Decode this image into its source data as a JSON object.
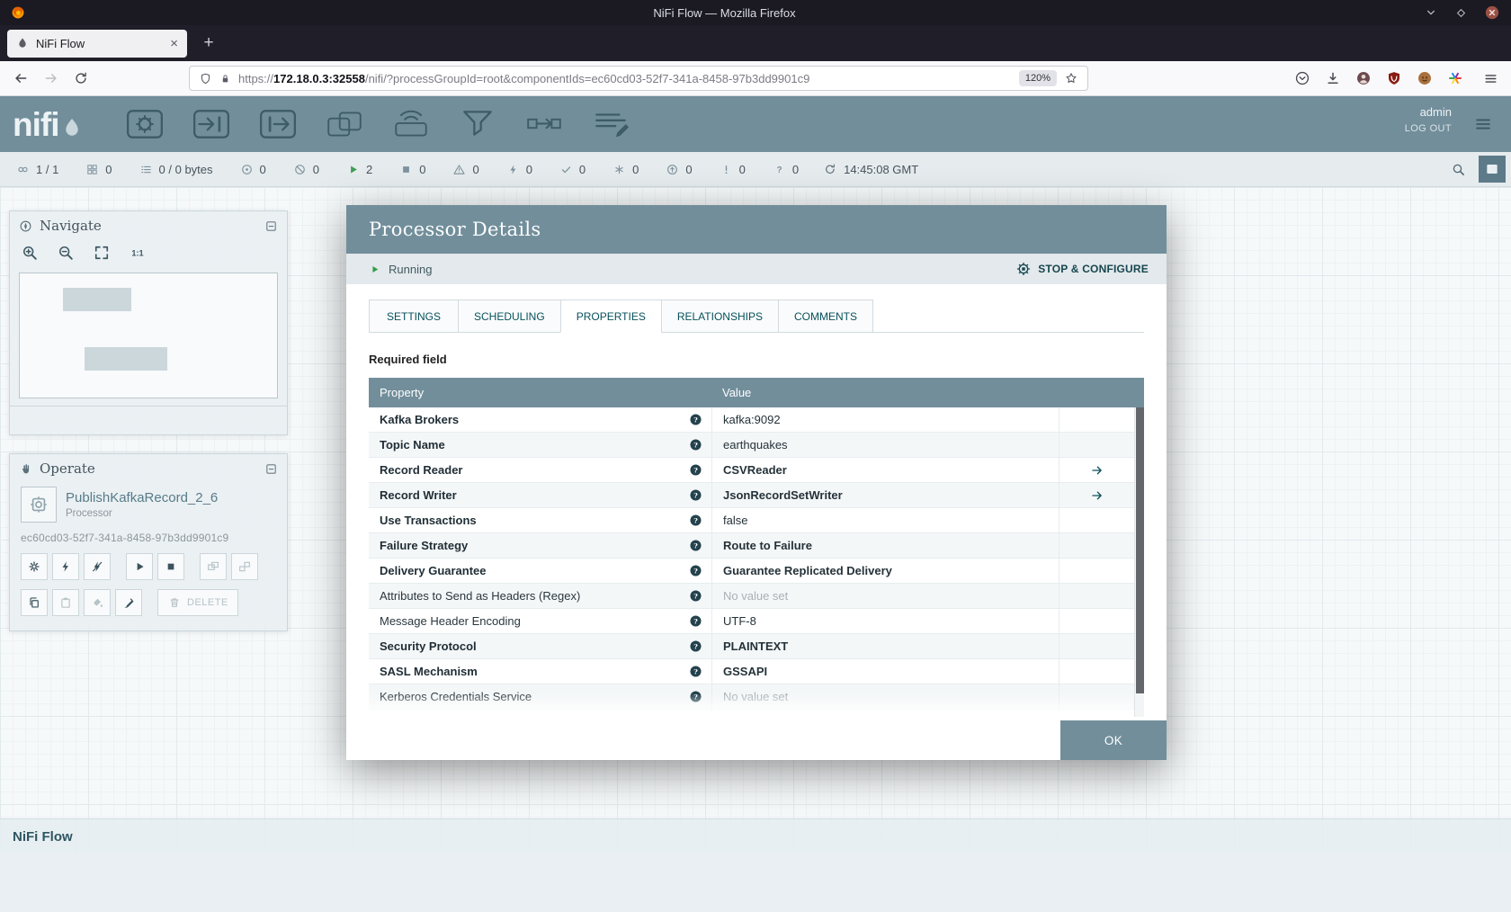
{
  "titlebar": {
    "title": "NiFi Flow — Mozilla Firefox"
  },
  "tabs": {
    "active_tab_title": "NiFi Flow",
    "new_tab_label": "+"
  },
  "navbar": {
    "url_scheme": "https://",
    "url_host": "172.18.0.3:32558",
    "url_path": "/nifi/?processGroupId=root&componentIds=ec60cd03-52f7-341a-8458-97b3dd9901c9",
    "zoom_badge": "120%",
    "right_icons": [
      "pocket-icon",
      "downloads-icon",
      "account-icon",
      "ublock-icon",
      "profile-icon",
      "extension-pinwheel-icon"
    ]
  },
  "nifi": {
    "logo_text": "nifi",
    "user": "admin",
    "logout_label": "LOG OUT",
    "toolbar_icons": [
      "processor-icon",
      "input-port-icon",
      "output-port-icon",
      "process-group-icon",
      "remote-process-group-icon",
      "funnel-icon",
      "template-icon",
      "label-icon"
    ]
  },
  "statusbar": {
    "items": [
      {
        "icon": "cluster-icon",
        "value": "1 / 1"
      },
      {
        "icon": "threads-icon",
        "value": "0"
      },
      {
        "icon": "queued-icon",
        "value": "0 / 0 bytes"
      },
      {
        "icon": "transmitting-icon",
        "value": "0"
      },
      {
        "icon": "not-transmitting-icon",
        "value": "0"
      },
      {
        "icon": "running-icon",
        "value": "2",
        "color": "#3f9e54"
      },
      {
        "icon": "stopped-icon",
        "value": "0"
      },
      {
        "icon": "invalid-icon",
        "value": "0"
      },
      {
        "icon": "disabled-icon",
        "value": "0"
      },
      {
        "icon": "up-to-date-icon",
        "value": "0"
      },
      {
        "icon": "locally-modified-icon",
        "value": "0"
      },
      {
        "icon": "stale-icon",
        "value": "0"
      },
      {
        "icon": "locally-modified-stale-icon",
        "value": "0"
      },
      {
        "icon": "sync-failure-icon",
        "value": "0"
      }
    ],
    "refresh_time": "14:45:08 GMT"
  },
  "navigate": {
    "title": "Navigate"
  },
  "operate": {
    "title": "Operate",
    "name": "PublishKafkaRecord_2_6",
    "type": "Processor",
    "id": "ec60cd03-52f7-341a-8458-97b3dd9901c9",
    "delete_label": "DELETE",
    "buttons_row1": [
      {
        "icon": "gear-icon",
        "disabled": false
      },
      {
        "icon": "bolt-icon",
        "disabled": false
      },
      {
        "icon": "bolt-slash-icon",
        "disabled": false
      },
      {
        "icon": "start-icon",
        "disabled": false
      },
      {
        "icon": "stop-icon",
        "disabled": false
      },
      {
        "icon": "group-icon",
        "disabled": true
      },
      {
        "icon": "ungroup-icon",
        "disabled": true
      }
    ],
    "buttons_row2": [
      {
        "icon": "copy-icon",
        "disabled": false
      },
      {
        "icon": "paste-icon",
        "disabled": true
      },
      {
        "icon": "fill-color-icon",
        "disabled": true
      },
      {
        "icon": "brush-icon",
        "disabled": false
      }
    ]
  },
  "dialog": {
    "title": "Processor Details",
    "status": "Running",
    "action": "STOP & CONFIGURE",
    "tabs": [
      "SETTINGS",
      "SCHEDULING",
      "PROPERTIES",
      "RELATIONSHIPS",
      "COMMENTS"
    ],
    "active_tab": "PROPERTIES",
    "required_note": "Required field",
    "ok_label": "OK",
    "table": {
      "headers": [
        "Property",
        "Value"
      ],
      "rows": [
        {
          "property": "Kafka Brokers",
          "required": true,
          "value": "kafka:9092",
          "empty": false,
          "emph": false,
          "goto": false
        },
        {
          "property": "Topic Name",
          "required": true,
          "value": "earthquakes",
          "empty": false,
          "emph": false,
          "goto": false
        },
        {
          "property": "Record Reader",
          "required": true,
          "value": "CSVReader",
          "empty": false,
          "emph": true,
          "goto": true
        },
        {
          "property": "Record Writer",
          "required": true,
          "value": "JsonRecordSetWriter",
          "empty": false,
          "emph": true,
          "goto": true
        },
        {
          "property": "Use Transactions",
          "required": true,
          "value": "false",
          "empty": false,
          "emph": false,
          "goto": false
        },
        {
          "property": "Failure Strategy",
          "required": true,
          "value": "Route to Failure",
          "empty": false,
          "emph": true,
          "goto": false
        },
        {
          "property": "Delivery Guarantee",
          "required": true,
          "value": "Guarantee Replicated Delivery",
          "empty": false,
          "emph": true,
          "goto": false
        },
        {
          "property": "Attributes to Send as Headers (Regex)",
          "required": false,
          "value": "No value set",
          "empty": true,
          "emph": false,
          "goto": false
        },
        {
          "property": "Message Header Encoding",
          "required": false,
          "value": "UTF-8",
          "empty": false,
          "emph": false,
          "goto": false
        },
        {
          "property": "Security Protocol",
          "required": true,
          "value": "PLAINTEXT",
          "empty": false,
          "emph": true,
          "goto": false
        },
        {
          "property": "SASL Mechanism",
          "required": true,
          "value": "GSSAPI",
          "empty": false,
          "emph": true,
          "goto": false
        },
        {
          "property": "Kerberos Credentials Service",
          "required": false,
          "value": "No value set",
          "empty": true,
          "emph": false,
          "goto": false
        }
      ]
    }
  },
  "breadcrumb": {
    "label": "NiFi Flow"
  }
}
